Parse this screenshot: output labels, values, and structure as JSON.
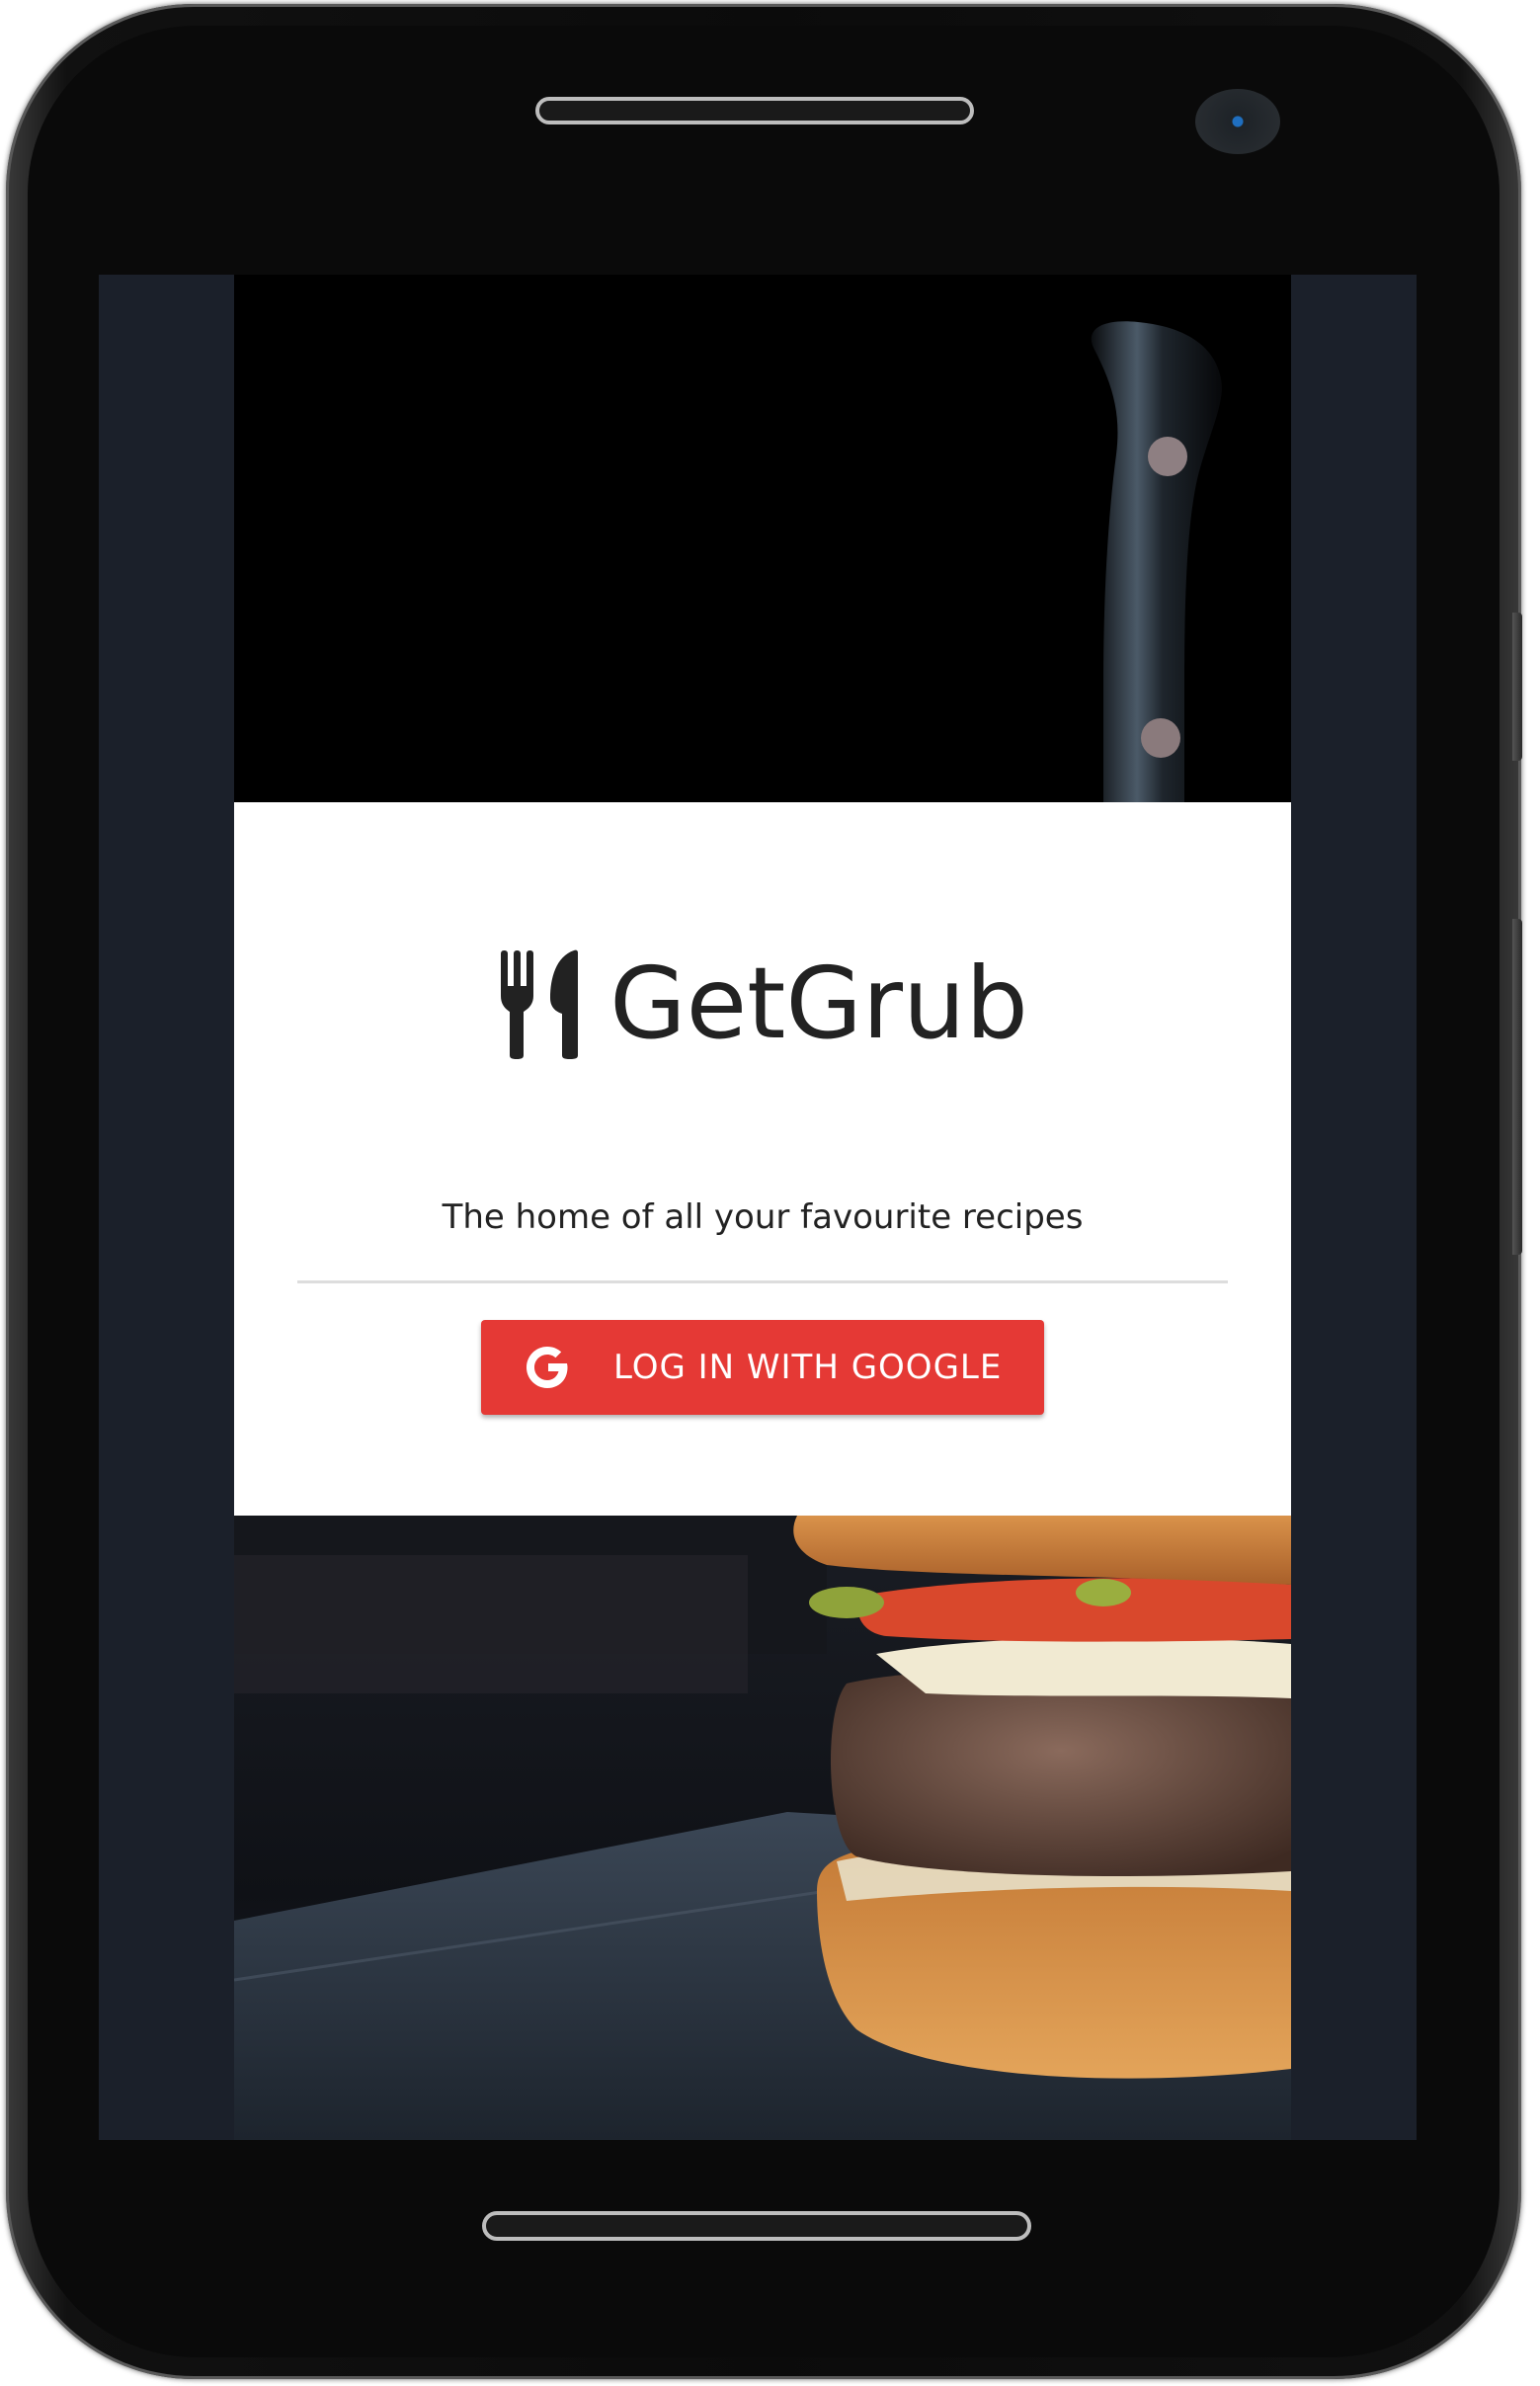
{
  "app": {
    "name": "GetGrub",
    "tagline": "The home of all your favourite recipes"
  },
  "login": {
    "button_label": "LOG IN WITH GOOGLE",
    "button_icon": "google-g-icon"
  },
  "images": {
    "top": "knife-photo",
    "bottom": "burger-photo"
  },
  "colors": {
    "accent": "#e53935",
    "card": "#ffffff",
    "screen_background": "#1b202a",
    "text": "#222222"
  }
}
